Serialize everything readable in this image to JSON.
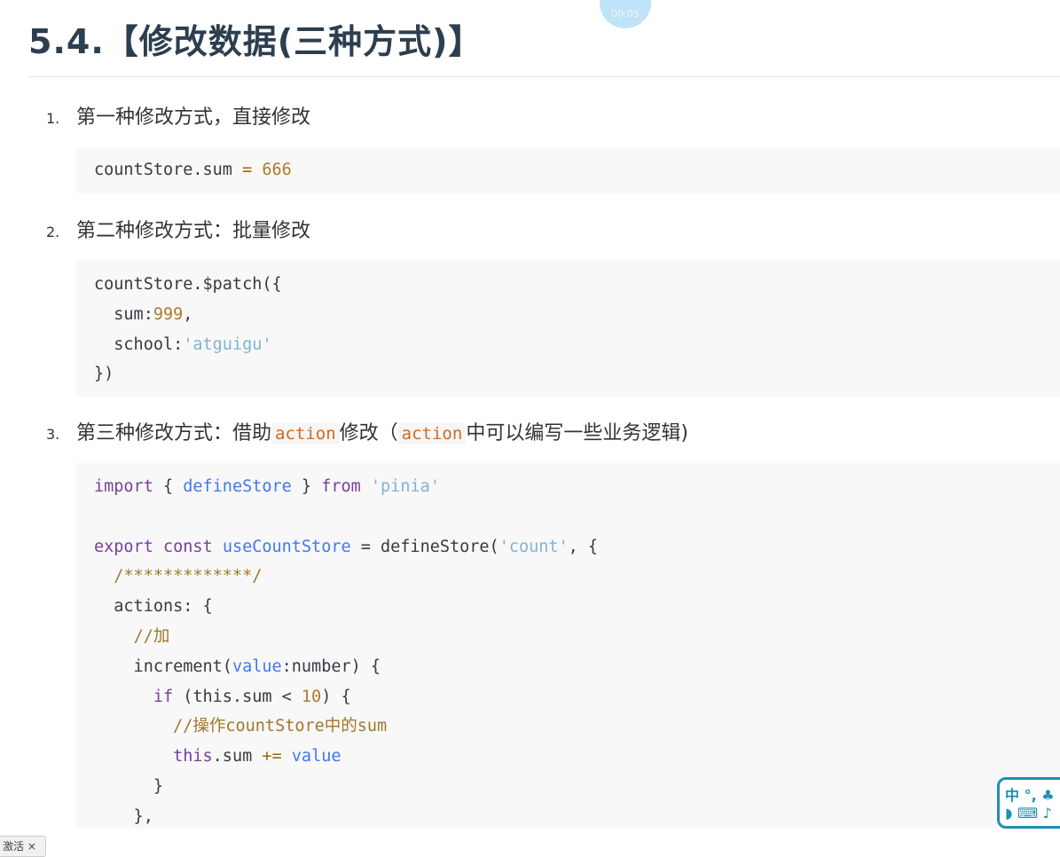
{
  "title": "5.4.【修改数据(三种方式)】",
  "timer": "00:05",
  "items": [
    {
      "num": "1.",
      "text": "第一种修改方式，直接修改"
    },
    {
      "num": "2.",
      "text": "第二种修改方式：批量修改"
    },
    {
      "num": "3.",
      "text_a": "第三种修改方式：借助",
      "code_a": "action",
      "text_b": "修改（",
      "code_b": "action",
      "text_c": "中可以编写一些业务逻辑)"
    }
  ],
  "code1": [
    "countStore.sum = 666"
  ],
  "code2": [
    "countStore.$patch({",
    "  sum:999,",
    "  school:'atguigu'",
    "})"
  ],
  "code3": [
    "import { defineStore } from 'pinia'",
    "",
    "export const useCountStore = defineStore('count', {",
    "  /*************/",
    "  actions: {",
    "    //加",
    "    increment(value:number) {",
    "      if (this.sum < 10) {",
    "        //操作countStore中的sum",
    "        this.sum += value",
    "      }",
    "    },"
  ],
  "ime": {
    "line1": "中 °, ♣",
    "line2": "◗ ⌨ ♪"
  },
  "bottom_tab": "激活 ×"
}
